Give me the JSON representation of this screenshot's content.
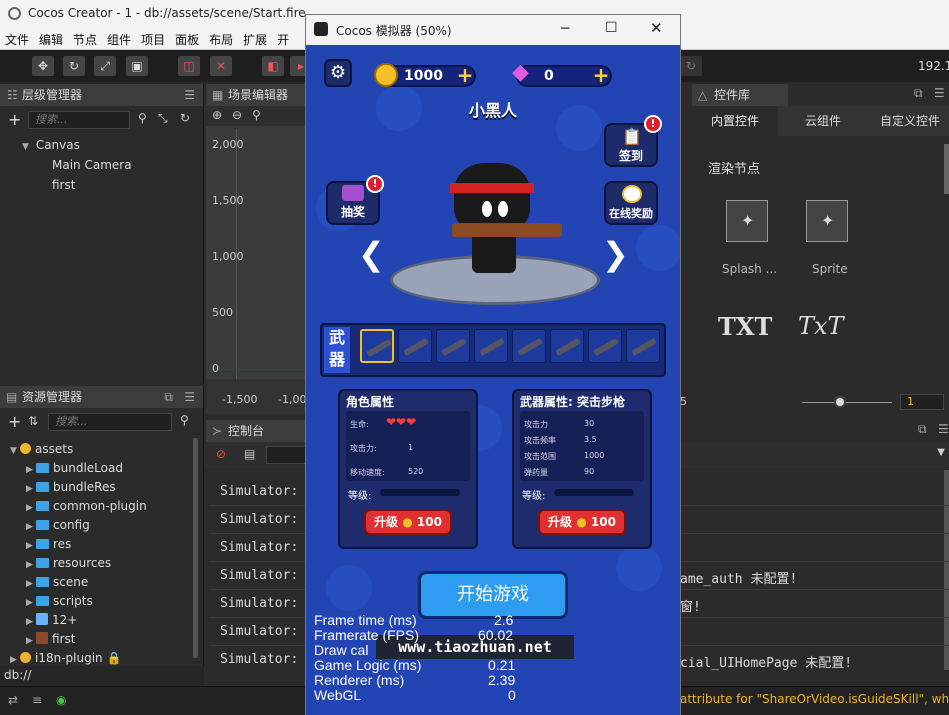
{
  "window": {
    "title": "Cocos Creator - 1 - db://assets/scene/Start.fire"
  },
  "menu": [
    "文件",
    "编辑",
    "节点",
    "组件",
    "项目",
    "面板",
    "布局",
    "扩展",
    "开"
  ],
  "toolbar": {
    "ip": "192.16"
  },
  "hierarchy": {
    "title": "层级管理器",
    "search_placeholder": "搜索...",
    "nodes": [
      "Canvas",
      "Main Camera",
      "first"
    ]
  },
  "scene_editor": {
    "title": "场景编辑器",
    "y_ticks": [
      "2,000",
      "1,500",
      "1,000",
      "500",
      "0"
    ],
    "x_ticks": [
      "-1,500",
      "-1,00"
    ],
    "right_tick": "5"
  },
  "assets": {
    "title": "资源管理器",
    "search_placeholder": "搜索...",
    "root": "assets",
    "folders": [
      "bundleLoad",
      "bundleRes",
      "common-plugin",
      "config",
      "res",
      "resources",
      "scene",
      "scripts"
    ],
    "files": [
      "12+",
      "first"
    ],
    "extra": "i18n-plugin",
    "path": "db://"
  },
  "console": {
    "title": "控制台",
    "lines": [
      "Simulator:",
      "Simulator:",
      "Simulator:",
      "Simulator:",
      "Simulator:",
      "Simulator:",
      "Simulator:"
    ],
    "right_texts": [
      "ame_auth 未配置!",
      "窗!",
      "cial_UIHomePage 未配置!"
    ],
    "warning": "attribute for \"ShareOrVideo.isGuideSKill\", which its"
  },
  "widgets": {
    "title": "控件库",
    "tabs": [
      "内置控件",
      "云组件",
      "自定义控件"
    ],
    "section": "渲染节点",
    "items": [
      "Splash ...",
      "Sprite"
    ],
    "text_items": [
      "TXT",
      "TxT"
    ],
    "slider_value": "1"
  },
  "simulator": {
    "title": "Cocos 模拟器 (50%)",
    "coins": "1000",
    "gems": "0",
    "hero_name": "小黑人",
    "btn_signin": "签到",
    "btn_lottery": "抽奖",
    "btn_online": "在线奖励",
    "weapons_label": "武器",
    "char_panel": {
      "title": "角色属性",
      "stats": [
        "生命:",
        "攻击力:",
        "移动速度:"
      ],
      "values": [
        "",
        "1",
        "520"
      ],
      "level": "等级:",
      "upgrade": "升级",
      "cost": "100"
    },
    "weapon_panel": {
      "title": "武器属性: 突击步枪",
      "stats": [
        "攻击力",
        "攻击频率",
        "攻击范围",
        "弹药量"
      ],
      "values": [
        "30",
        "3.5",
        "1000",
        "90"
      ],
      "level": "等级:",
      "upgrade": "升级",
      "cost": "100"
    },
    "start": "开始游戏",
    "watermark": "www.tiaozhuan.net",
    "perf_labels": [
      "Frame time (ms)",
      "Framerate (FPS)",
      "Draw cal",
      "Game Logic (ms)",
      "Renderer (ms)",
      "WebGL"
    ],
    "perf_values": [
      "2.6",
      "60.02",
      "",
      "0.21",
      "2.39",
      "0"
    ]
  },
  "colors": {
    "game_bg": "#2245b3",
    "accent": "#3ea2e6",
    "warning": "#f0b428"
  }
}
